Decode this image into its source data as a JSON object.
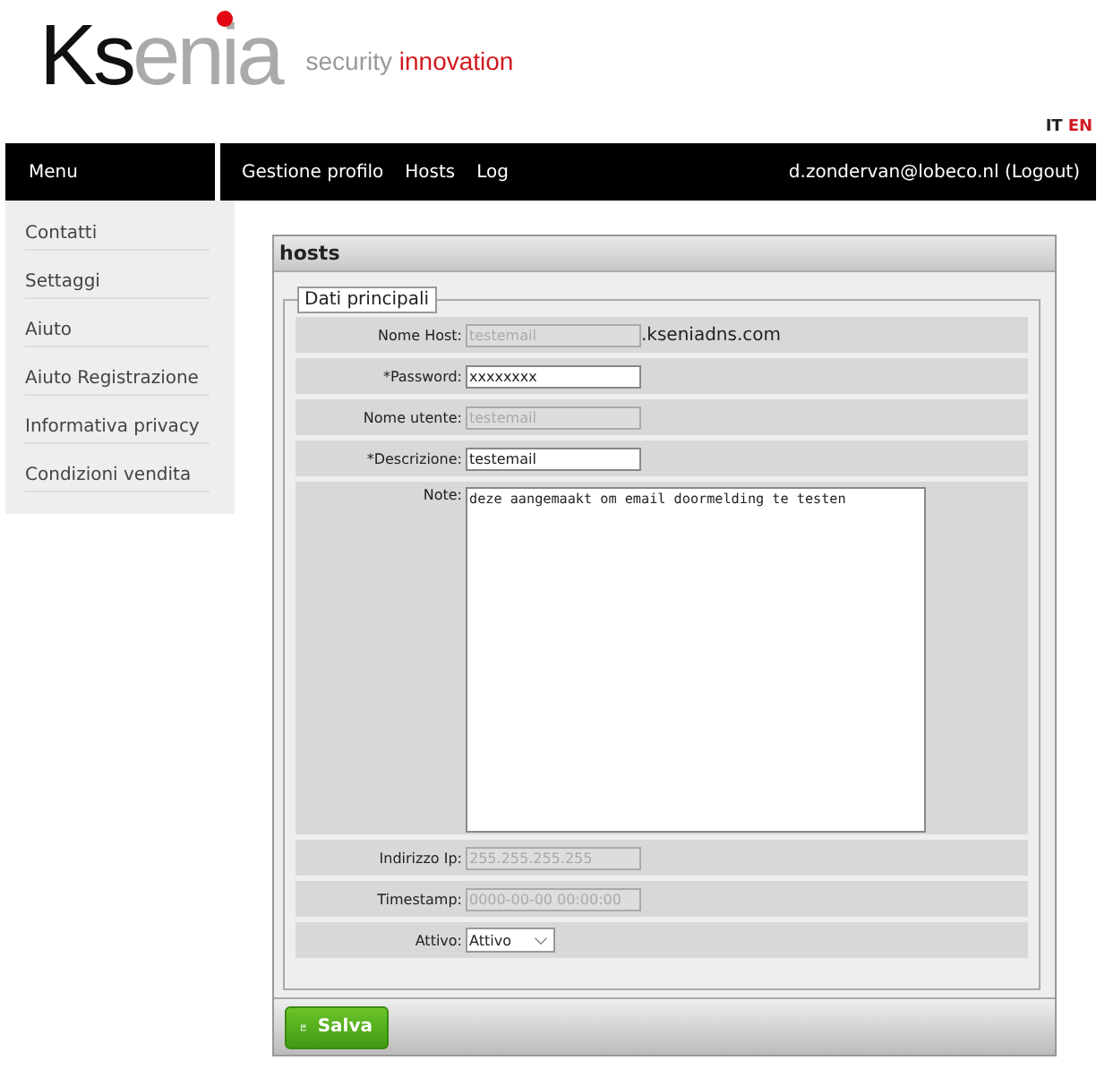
{
  "logo": {
    "dark": "Ks",
    "light": "enia"
  },
  "tagline": {
    "plain": "security",
    "accent": "innovation"
  },
  "languages": [
    {
      "label": "IT",
      "selected": false
    },
    {
      "label": "EN",
      "selected": true
    }
  ],
  "menu_title": "Menu",
  "nav": [
    "Gestione profilo",
    "Hosts",
    "Log"
  ],
  "user": "d.zondervan@lobeco.nl (Logout)",
  "sidebar": {
    "items": [
      "Contatti",
      "Settaggi",
      "Aiuto",
      "Aiuto Registrazione",
      "Informativa privacy",
      "Condizioni vendita"
    ]
  },
  "panel": {
    "title": "hosts",
    "legend": "Dati principali",
    "fields": [
      {
        "kind": "text",
        "label": "Nome Host:",
        "value": "testemail",
        "disabled": true,
        "suffix": ".kseniadns.com"
      },
      {
        "kind": "text",
        "label": "*Password:",
        "value": "xxxxxxxx",
        "disabled": false
      },
      {
        "kind": "text",
        "label": "Nome utente:",
        "value": "testemail",
        "disabled": true
      },
      {
        "kind": "text",
        "label": "*Descrizione:",
        "value": "testemail",
        "disabled": false
      },
      {
        "kind": "textarea",
        "label": "Note:",
        "value": "deze aangemaakt om email doormelding te testen",
        "disabled": false
      },
      {
        "kind": "text",
        "label": "Indirizzo Ip:",
        "value": "255.255.255.255",
        "disabled": true
      },
      {
        "kind": "text",
        "label": "Timestamp:",
        "value": "0000-00-00 00:00:00",
        "disabled": true
      },
      {
        "kind": "select",
        "label": "Attivo:",
        "value": "Attivo",
        "disabled": false
      }
    ],
    "save_button": "Salva"
  }
}
